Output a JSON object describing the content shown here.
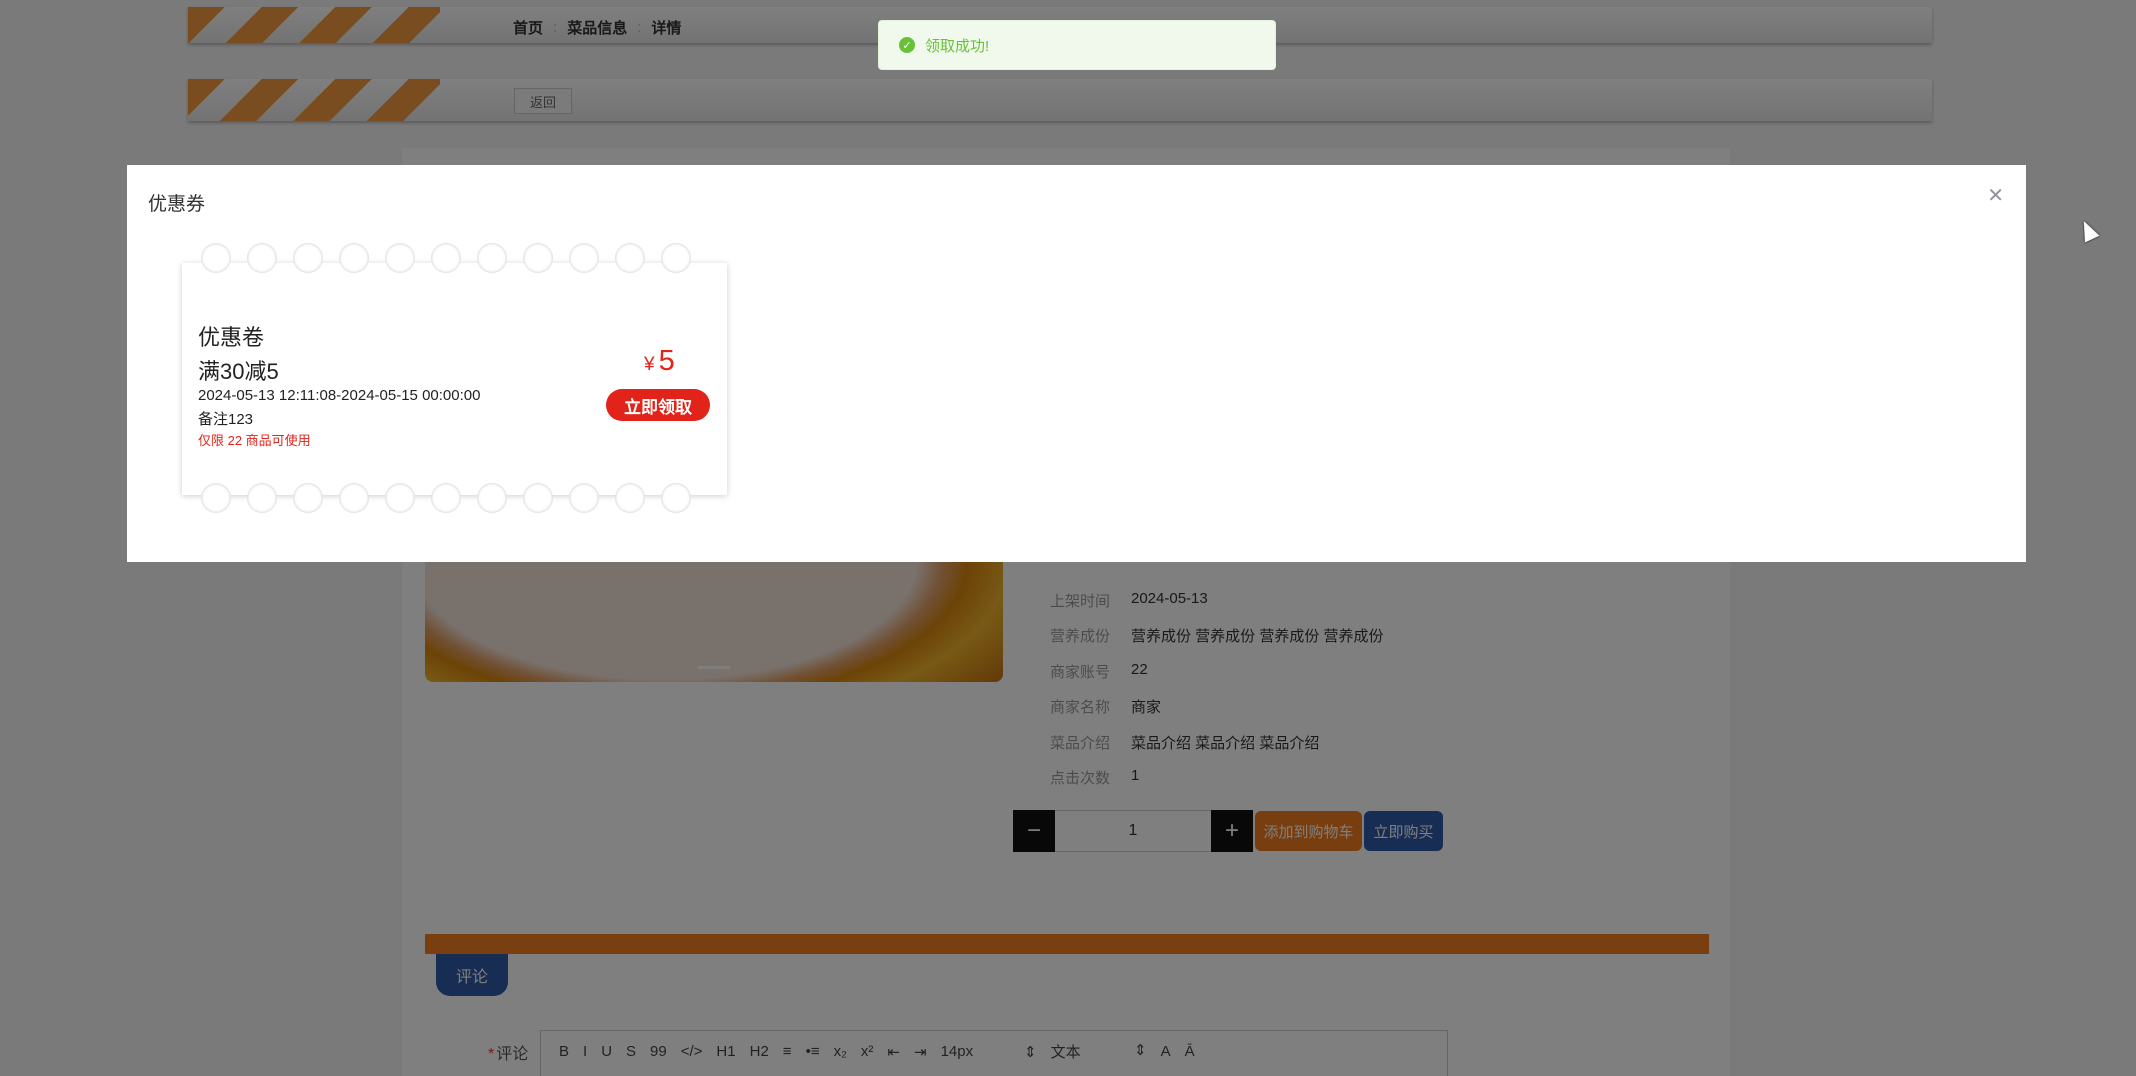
{
  "breadcrumb": {
    "home": "首页",
    "category": "菜品信息",
    "current": "详情"
  },
  "back_label": "返回",
  "details": [
    {
      "key": "上架时间",
      "value": "2024-05-13"
    },
    {
      "key": "营养成份",
      "value": "营养成份 营养成份 营养成份 营养成份"
    },
    {
      "key": "商家账号",
      "value": "22"
    },
    {
      "key": "商家名称",
      "value": "商家"
    },
    {
      "key": "菜品介绍",
      "value": "菜品介绍 菜品介绍 菜品介绍"
    },
    {
      "key": "点击次数",
      "value": "1"
    }
  ],
  "quantity": {
    "minus": "−",
    "value": "1",
    "plus": "+"
  },
  "actions": {
    "add_to_cart": "添加到购物车",
    "buy_now": "立即购买"
  },
  "comment_tab": "评论",
  "comment_field": {
    "required_mark": "*",
    "label": "评论"
  },
  "editor_toolbar": [
    "B",
    "I",
    "U",
    "S",
    "99",
    "</>",
    "H1",
    "H2",
    "≡",
    "•≡",
    "x₂",
    "x²",
    "⇤",
    "⇥",
    "14px",
    "文本",
    "A",
    "Ā"
  ],
  "toast": {
    "message": "领取成功!"
  },
  "dialog": {
    "title": "优惠券",
    "coupon": {
      "name": "优惠卷",
      "rule": "满30减5",
      "validity": "2024-05-13 12:11:08-2024-05-15 00:00:00",
      "note": "备注123",
      "limit": "仅限 22 商品可使用",
      "currency": "¥",
      "amount": "5",
      "claim_label": "立即领取"
    }
  }
}
